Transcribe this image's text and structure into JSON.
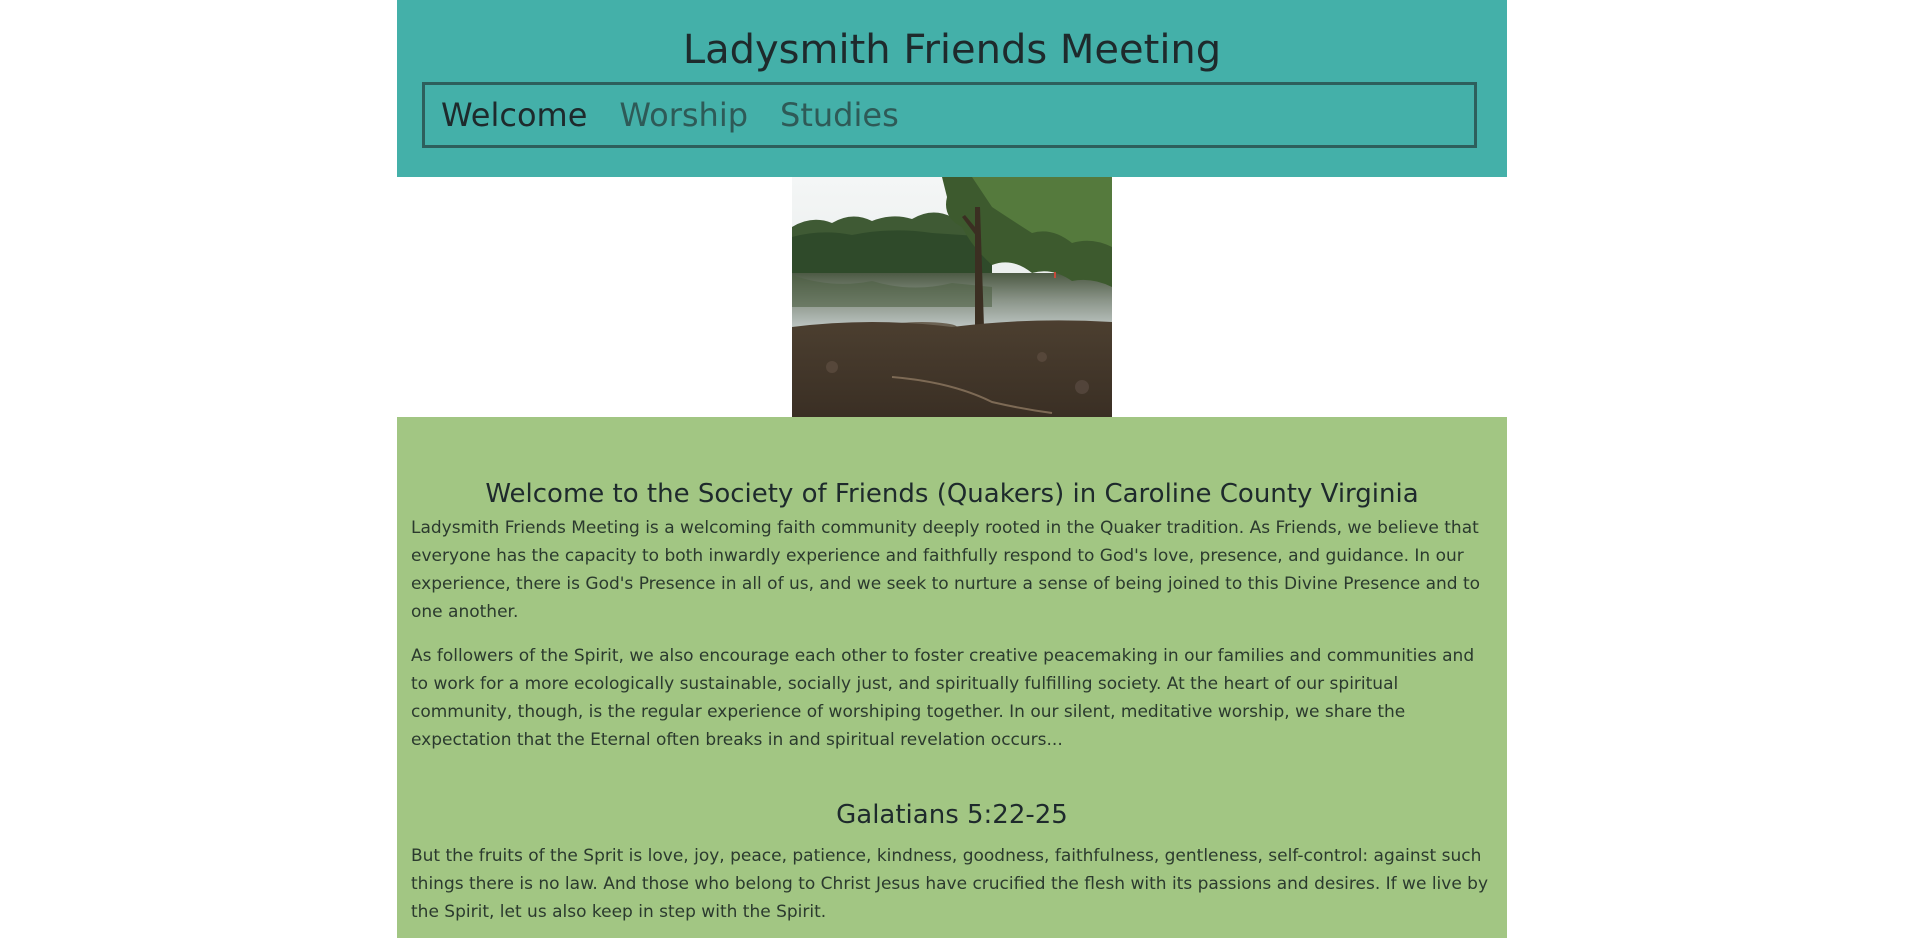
{
  "header": {
    "title": "Ladysmith Friends Meeting",
    "nav": [
      {
        "label": "Welcome",
        "active": true
      },
      {
        "label": "Worship",
        "active": false
      },
      {
        "label": "Studies",
        "active": false
      }
    ],
    "background_color": "#44b0a9"
  },
  "hero": {
    "image_description": "Lake shore with a tree and reflections on the water"
  },
  "content": {
    "background_color": "#a2c683",
    "welcome_heading": "Welcome to the Society of Friends (Quakers) in Caroline County Virginia",
    "paragraph_1": "Ladysmith Friends Meeting is a welcoming faith community deeply rooted in the Quaker tradition. As Friends, we believe that everyone has the capacity to both inwardly experience and faithfully respond to God's love, presence, and guidance. In our experience, there is God's Presence in all of us, and we seek to nurture a sense of being joined to this Divine Presence and to one another.",
    "paragraph_2": "As followers of the Spirit, we also encourage each other to foster creative peacemaking in our families and communities and to work for a more ecologically sustainable, socially just, and spiritually fulfilling society. At the heart of our spiritual community, though, is the regular experience of worshiping together. In our silent, meditative worship, we share the expectation that the Eternal often breaks in and spiritual revelation occurs...",
    "verse_heading": "Galatians 5:22-25",
    "verse_text": "But the fruits of the Sprit is love, joy, peace, patience, kindness, goodness, faithfulness, gentleness, self-control: against such things there is no law. And those who belong to Christ Jesus have crucified the flesh with its passions and desires. If we live by the Spirit, let us also keep in step with the Spirit."
  }
}
